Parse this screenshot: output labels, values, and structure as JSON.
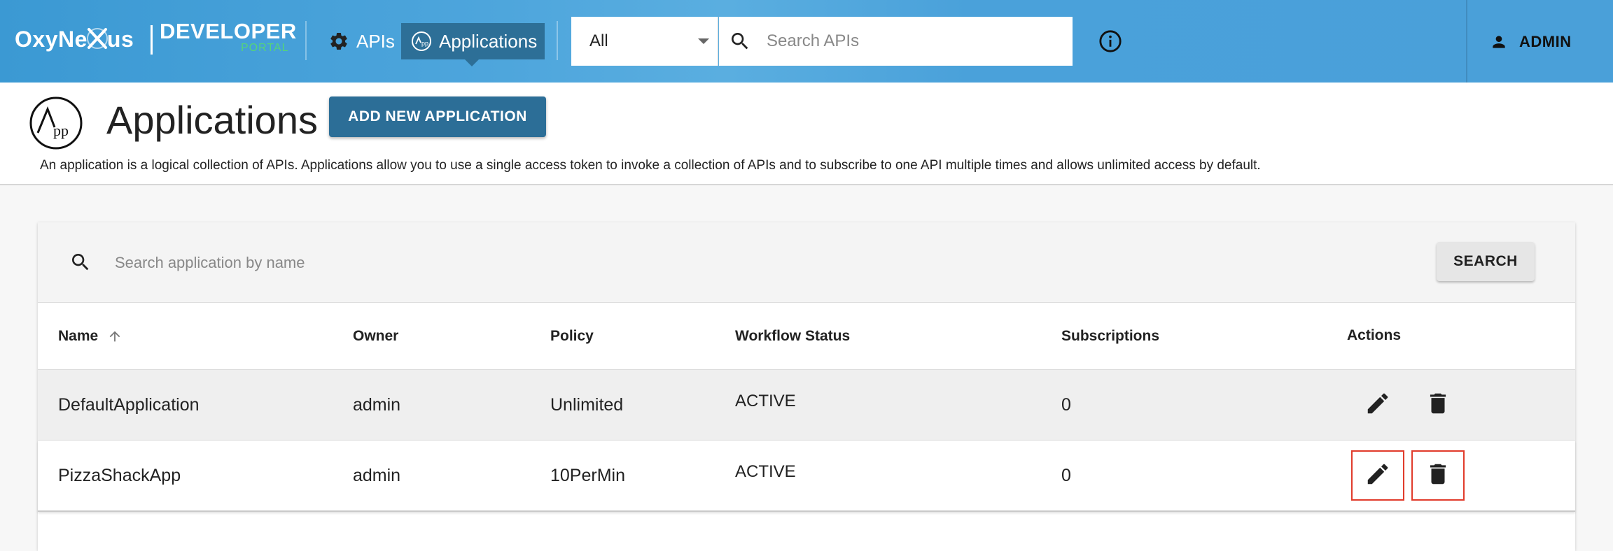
{
  "topbar": {
    "logo_brand": "OxyNe",
    "logo_brand_end": "us",
    "logo_developer": "DEVELOPER",
    "logo_portal": "PORTAL",
    "nav": [
      {
        "label": "APIs",
        "icon": "gear-icon"
      },
      {
        "label": "Applications",
        "icon": "applications-icon",
        "active": true
      }
    ],
    "search_scope": "All",
    "search_placeholder": "Search APIs",
    "user_label": "ADMIN"
  },
  "header": {
    "title": "Applications",
    "add_button": "ADD NEW APPLICATION",
    "description": "An application is a logical collection of APIs. Applications allow you to use a single access token to invoke a collection of APIs and to subscribe to one API multiple times and allows unlimited access by default."
  },
  "card": {
    "search_placeholder": "Search application by name",
    "search_button": "SEARCH"
  },
  "table": {
    "columns": [
      "Name",
      "Owner",
      "Policy",
      "Workflow Status",
      "Subscriptions",
      "Actions"
    ],
    "sort": {
      "column": "Name",
      "direction": "ascending"
    },
    "rows": [
      {
        "name": "DefaultApplication",
        "owner": "admin",
        "policy": "Unlimited",
        "status": "ACTIVE",
        "subscriptions": "0"
      },
      {
        "name": "PizzaShackApp",
        "owner": "admin",
        "policy": "10PerMin",
        "status": "ACTIVE",
        "subscriptions": "0"
      }
    ]
  },
  "colors": {
    "topbar": "#4aa0d9",
    "nav_active": "#2d6f97",
    "primary_button": "#2c6e97",
    "portal_text": "#55d47a",
    "highlight": "#e13b2b"
  }
}
